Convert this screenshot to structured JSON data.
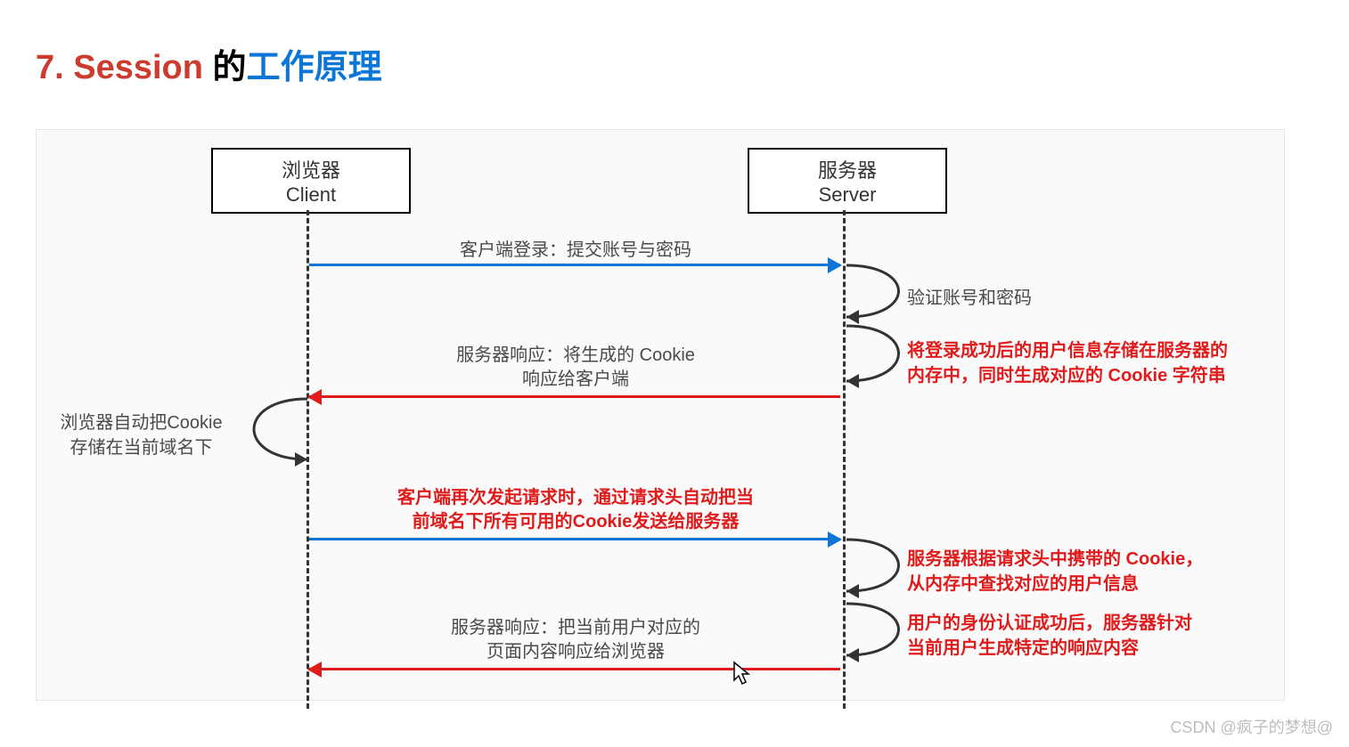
{
  "heading": {
    "number": "7. ",
    "session": "Session ",
    "de": "的",
    "work": "工作原理"
  },
  "participants": {
    "client": {
      "line1": "浏览器",
      "line2": "Client"
    },
    "server": {
      "line1": "服务器",
      "line2": "Server"
    }
  },
  "messages": {
    "m1": "客户端登录：提交账号与密码",
    "m2_l1": "服务器响应：将生成的 Cookie",
    "m2_l2": "响应给客户端",
    "m3_l1": "客户端再次发起请求时，通过请求头自动把当",
    "m3_l2": "前域名下所有可用的Cookie发送给服务器",
    "m4_l1": "服务器响应：把当前用户对应的",
    "m4_l2": "页面内容响应给浏览器"
  },
  "self_notes": {
    "s1": "验证账号和密码",
    "s2_l1": "将登录成功后的用户信息存储在服务器的",
    "s2_l2": "内存中，同时生成对应的 Cookie 字符串",
    "s3_l1": "浏览器自动把Cookie",
    "s3_l2": "存储在当前域名下",
    "s4_l1": "服务器根据请求头中携带的 Cookie，",
    "s4_l2": "从内存中查找对应的用户信息",
    "s5_l1": "用户的身份认证成功后，服务器针对",
    "s5_l2": "当前用户生成特定的响应内容"
  },
  "colors": {
    "blue": "#0b76d6",
    "red": "#e01b1b"
  },
  "watermark": "CSDN @疯子的梦想@"
}
